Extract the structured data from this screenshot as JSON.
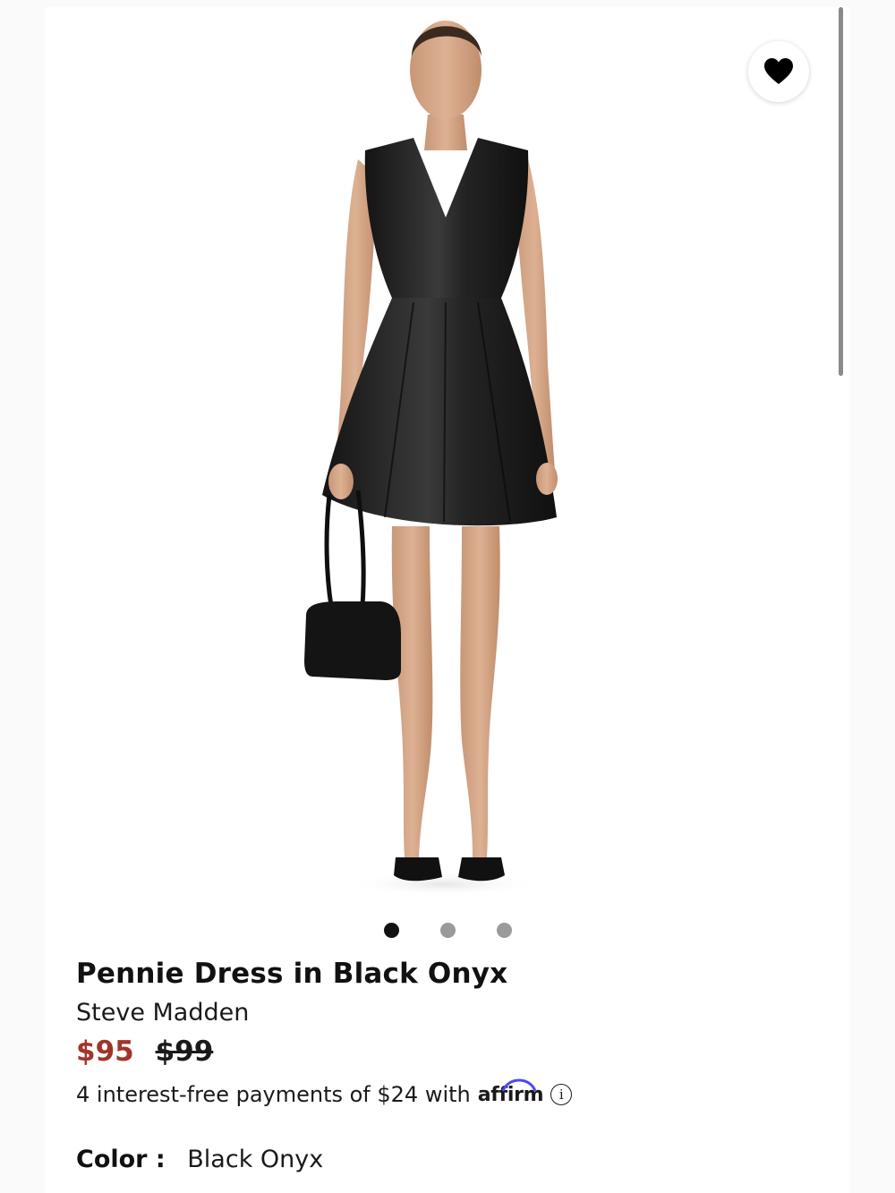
{
  "product": {
    "title": "Pennie Dress in Black Onyx",
    "brand": "Steve Madden",
    "price_sale": "$95",
    "price_original": "$99",
    "payments_text": "4 interest-free payments of $24 with",
    "payments_provider": "affirm",
    "info_glyph": "i",
    "color_label": "Color :",
    "color_value": "Black Onyx"
  },
  "gallery": {
    "image_count": 3,
    "active_index": 0
  },
  "icons": {
    "favorite": "heart-icon",
    "info": "info-icon"
  },
  "colors": {
    "sale_price": "#a1342b",
    "dot_active": "#111111",
    "dot_inactive": "#9a9a9a"
  }
}
